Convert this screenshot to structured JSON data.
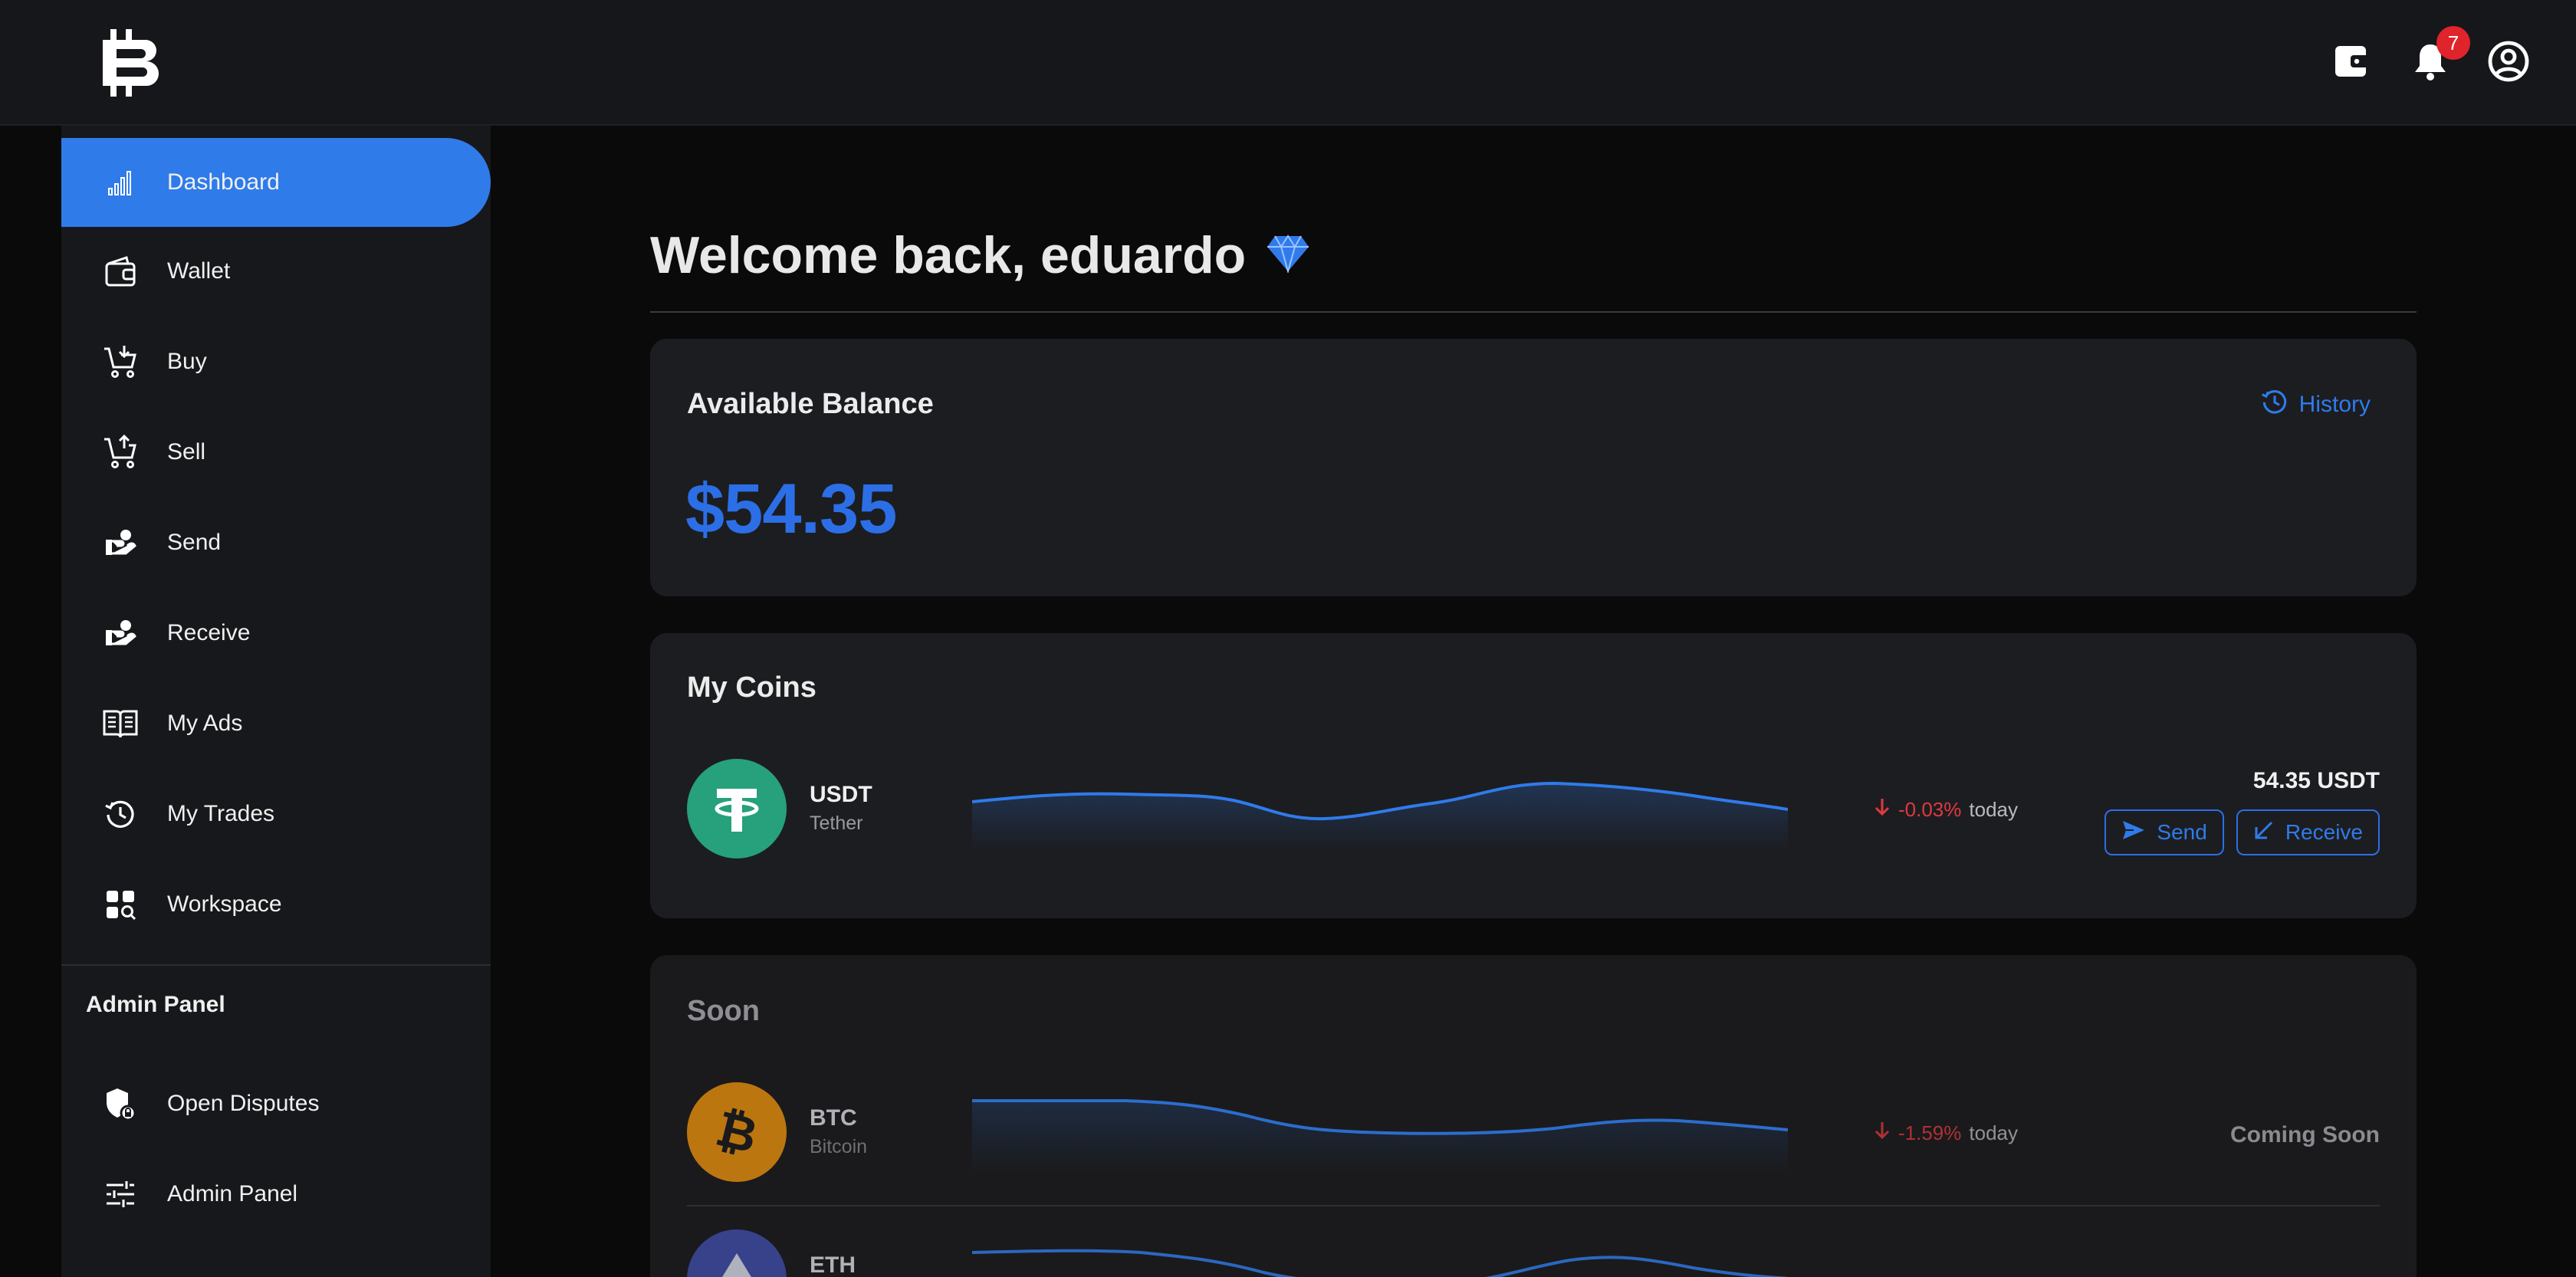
{
  "header": {
    "notification_count": "7",
    "icons": [
      "wallet-icon",
      "bell-icon",
      "account-icon"
    ]
  },
  "sidebar": {
    "items": [
      {
        "label": "Dashboard",
        "icon": "bar-chart-icon",
        "active": true
      },
      {
        "label": "Wallet",
        "icon": "wallet-icon"
      },
      {
        "label": "Buy",
        "icon": "cart-download-icon"
      },
      {
        "label": "Sell",
        "icon": "cart-upload-icon"
      },
      {
        "label": "Send",
        "icon": "hand-coin-icon"
      },
      {
        "label": "Receive",
        "icon": "hand-coin-icon"
      },
      {
        "label": "My Ads",
        "icon": "book-open-icon"
      },
      {
        "label": "My Trades",
        "icon": "history-icon"
      },
      {
        "label": "Workspace",
        "icon": "grid-search-icon"
      }
    ],
    "admin_section_title": "Admin Panel",
    "admin_items": [
      {
        "label": "Open Disputes",
        "icon": "shield-lock-icon"
      },
      {
        "label": "Admin Panel",
        "icon": "sliders-icon"
      }
    ]
  },
  "main": {
    "welcome": "Welcome back, eduardo",
    "welcome_icon": "diamond-icon",
    "balance_card": {
      "title": "Available Balance",
      "history_label": "History",
      "balance": "$54.35"
    },
    "my_coins": {
      "title": "My Coins",
      "coins": [
        {
          "symbol": "USDT",
          "name": "Tether",
          "change": "-0.03%",
          "change_suffix": "today",
          "amount": "54.35 USDT",
          "send_label": "Send",
          "receive_label": "Receive"
        }
      ]
    },
    "soon": {
      "title": "Soon",
      "coins": [
        {
          "symbol": "BTC",
          "name": "Bitcoin",
          "change": "-1.59%",
          "change_suffix": "today",
          "status": "Coming Soon"
        },
        {
          "symbol": "ETH",
          "name": "",
          "change": "",
          "change_suffix": "",
          "status": ""
        }
      ]
    }
  },
  "colors": {
    "accent": "#2f7bea",
    "balance": "#2c6ee6",
    "negative": "#e0393f",
    "tether": "#26a17b",
    "bitcoin": "#d9870f",
    "ethereum": "#3d4a9e"
  }
}
